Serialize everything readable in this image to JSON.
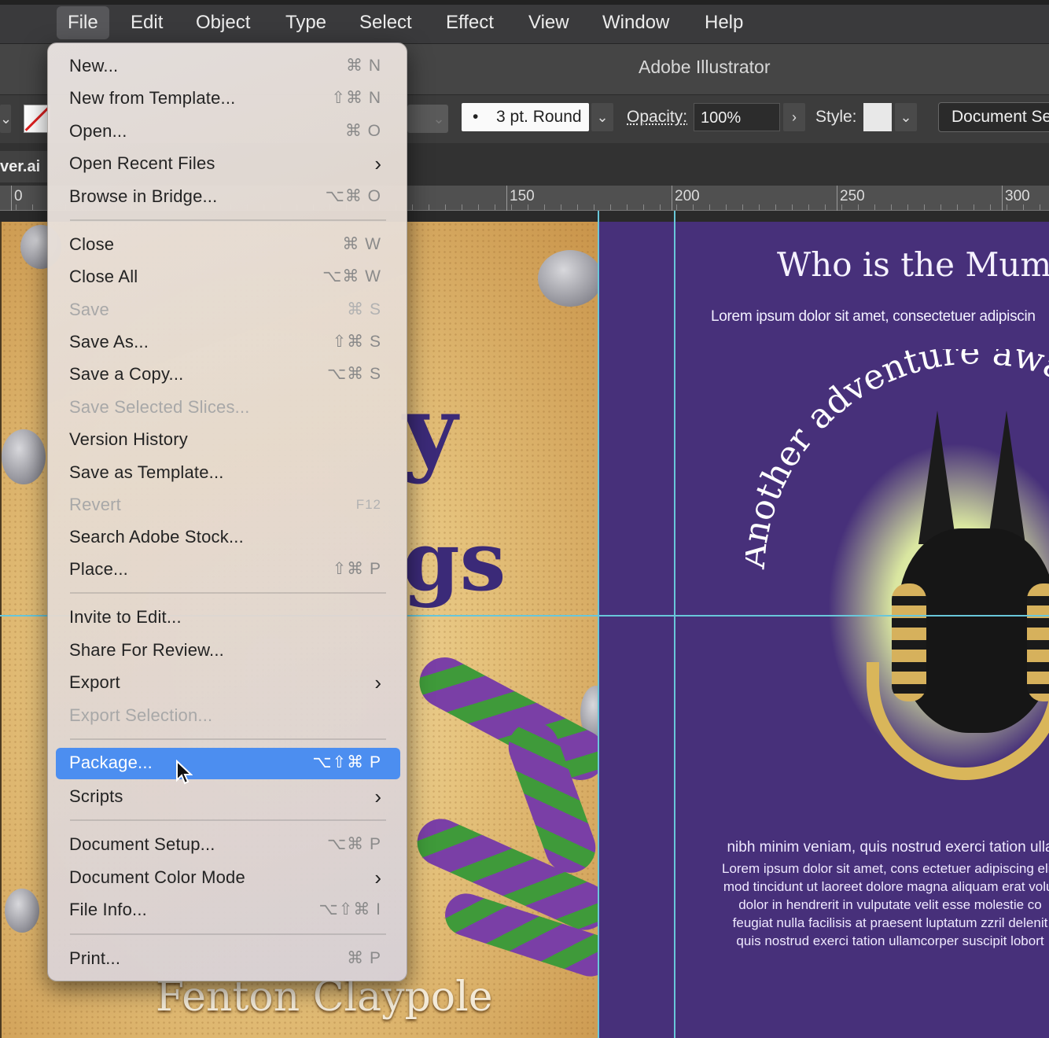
{
  "menubar": {
    "items": [
      "File",
      "Edit",
      "Object",
      "Type",
      "Select",
      "Effect",
      "View",
      "Window",
      "Help"
    ],
    "active": "File"
  },
  "app": {
    "title": "Adobe Illustrator"
  },
  "control_bar": {
    "brush": "3 pt. Round",
    "opacity_label": "Opacity:",
    "opacity_value": "100%",
    "style_label": "Style:",
    "document_setup": "Document Setup"
  },
  "tab": {
    "filename": "ver.ai"
  },
  "ruler": {
    "labels": [
      "0",
      "150",
      "200",
      "250",
      "300"
    ]
  },
  "file_menu": {
    "items": [
      {
        "label": "New...",
        "shortcut": "⌘ N"
      },
      {
        "label": "New from Template...",
        "shortcut": "⇧⌘ N"
      },
      {
        "label": "Open...",
        "shortcut": "⌘ O"
      },
      {
        "label": "Open Recent Files",
        "submenu": "›"
      },
      {
        "label": "Browse in Bridge...",
        "shortcut": "⌥⌘ O"
      },
      {
        "label": "Close",
        "shortcut": "⌘ W"
      },
      {
        "label": "Close All",
        "shortcut": "⌥⌘ W"
      },
      {
        "label": "Save",
        "shortcut": "⌘ S"
      },
      {
        "label": "Save As...",
        "shortcut": "⇧⌘ S"
      },
      {
        "label": "Save a Copy...",
        "shortcut": "⌥⌘ S"
      },
      {
        "label": "Save Selected Slices..."
      },
      {
        "label": "Version History"
      },
      {
        "label": "Save as Template..."
      },
      {
        "label": "Revert",
        "shortcut": "F12"
      },
      {
        "label": "Search Adobe Stock..."
      },
      {
        "label": "Place...",
        "shortcut": "⇧⌘ P"
      },
      {
        "label": "Invite to Edit..."
      },
      {
        "label": "Share For Review..."
      },
      {
        "label": "Export",
        "submenu": "›"
      },
      {
        "label": "Export Selection..."
      },
      {
        "label": "Package...",
        "shortcut": "⌥⇧⌘ P"
      },
      {
        "label": "Scripts",
        "submenu": "›"
      },
      {
        "label": "Document Setup...",
        "shortcut": "⌥⌘ P"
      },
      {
        "label": "Document Color Mode",
        "submenu": "›"
      },
      {
        "label": "File Info...",
        "shortcut": "⌥⇧⌘ I"
      },
      {
        "label": "Print...",
        "shortcut": "⌘ P"
      }
    ]
  },
  "artwork": {
    "left_letters": [
      "y",
      "gs"
    ],
    "author": "Fenton Claypole",
    "right_heading": "Who is the Mum-",
    "right_subline": "Lorem ipsum dolor sit amet, consectetuer adipiscin",
    "arc_text": "Another adventure awaits",
    "body_lines": [
      "nibh minim veniam, quis nostrud exerci tation ulla",
      "Lorem ipsum dolor sit amet, cons ectetuer adipiscing elit,",
      "mod tincidunt ut laoreet dolore magna aliquam erat volut",
      "dolor in hendrerit in vulputate velit esse molestie co",
      "feugiat nulla facilisis at praesent luptatum zzril delenit",
      "quis nostrud exerci tation ullamcorper suscipit lobort"
    ]
  },
  "colors": {
    "highlight": "#4c8ef0",
    "right_page": "#47307a",
    "guides": "#69c7da"
  }
}
